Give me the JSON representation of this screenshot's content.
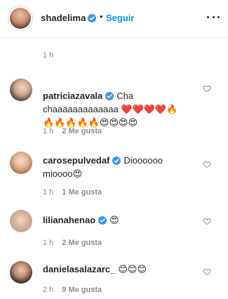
{
  "header": {
    "username": "shadelima",
    "separator": "•",
    "follow_label": "Seguir"
  },
  "top_meta": {
    "time": "1 h"
  },
  "comments": [
    {
      "username": "patriciazavala",
      "text": "Cha chaaaaaaaaaaaaa ❤️❤️❤️❤️🔥🔥🔥🔥🔥🔥😍😍😍😍",
      "time": "1 h",
      "likes": "2 Me gusta"
    },
    {
      "username": "carosepulvedaf",
      "text": "Dioooooo mioooo😍",
      "time": "1 h",
      "likes": "1 Me gusta"
    },
    {
      "username": "lilianahenao",
      "text": "😍",
      "time": "1 h",
      "likes": "2 Me gusta"
    },
    {
      "username": "danielasalazarc_",
      "text": "😊😊😊",
      "time": "2 h",
      "likes": "9 Me gusta"
    }
  ],
  "colors": {
    "link_blue": "#0095f6",
    "verified_blue": "#3897f0",
    "meta_grey": "#8e8e8e",
    "text": "#262626"
  },
  "icons": [
    "verified-badge-icon",
    "more-options-icon",
    "heart-outline-icon"
  ]
}
